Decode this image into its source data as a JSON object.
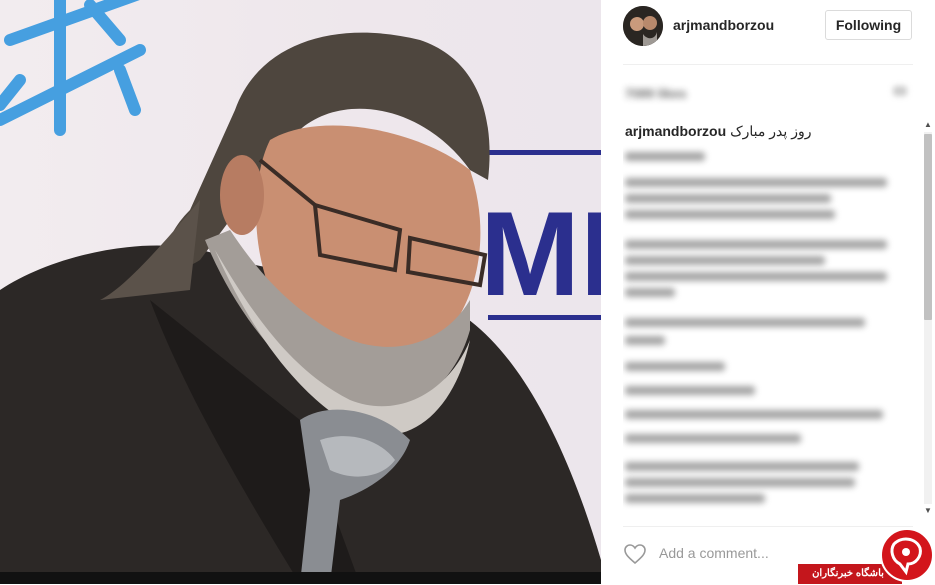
{
  "post": {
    "username": "arjmandborzou",
    "follow_label": "Following",
    "likes_text": "7089 likes",
    "caption_user": "arjmandborzou",
    "caption_text": "روز پدر مبارک",
    "add_comment_placeholder": "Add a comment..."
  },
  "watermark": {
    "text": "باشگاه خبرنگاران"
  },
  "colors": {
    "text": "#262626",
    "border": "#dbdbdb",
    "watermark_red": "#c4161c"
  },
  "icons": {
    "heart": "heart-outline-icon",
    "more": "ellipsis-icon",
    "scroll_up": "chevron-up-icon",
    "scroll_down": "chevron-down-icon"
  }
}
